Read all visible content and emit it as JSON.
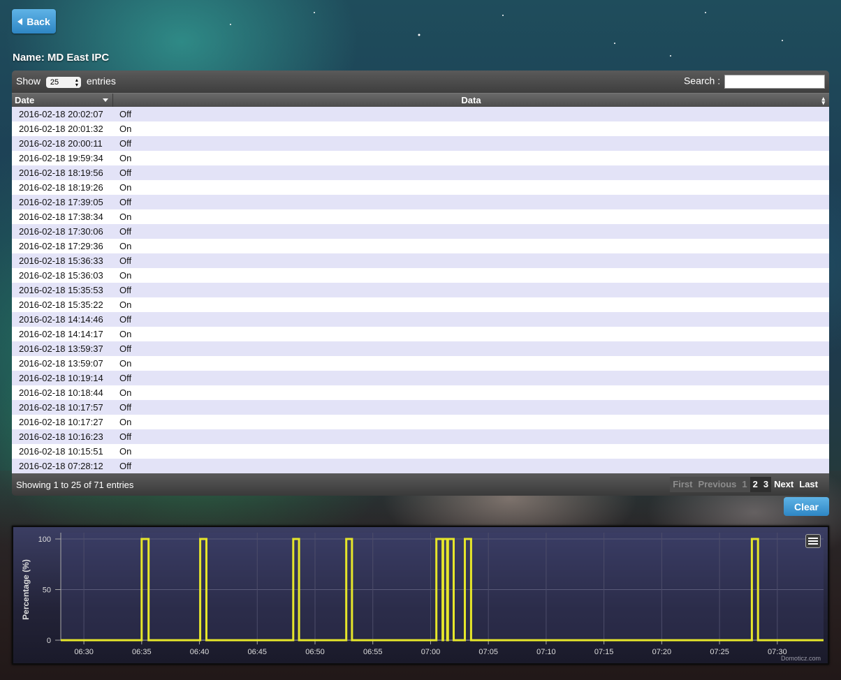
{
  "page": {
    "back_label": "Back",
    "name_label": "Name:",
    "name_value": "MD East IPC"
  },
  "table_controls": {
    "show_prefix": "Show",
    "page_size": "25",
    "show_suffix": "entries",
    "search_label": "Search :",
    "search_value": ""
  },
  "columns": [
    "Date",
    "Data"
  ],
  "rows": [
    {
      "date": "2016-02-18 20:02:07",
      "data": "Off"
    },
    {
      "date": "2016-02-18 20:01:32",
      "data": "On"
    },
    {
      "date": "2016-02-18 20:00:11",
      "data": "Off"
    },
    {
      "date": "2016-02-18 19:59:34",
      "data": "On"
    },
    {
      "date": "2016-02-18 18:19:56",
      "data": "Off"
    },
    {
      "date": "2016-02-18 18:19:26",
      "data": "On"
    },
    {
      "date": "2016-02-18 17:39:05",
      "data": "Off"
    },
    {
      "date": "2016-02-18 17:38:34",
      "data": "On"
    },
    {
      "date": "2016-02-18 17:30:06",
      "data": "Off"
    },
    {
      "date": "2016-02-18 17:29:36",
      "data": "On"
    },
    {
      "date": "2016-02-18 15:36:33",
      "data": "Off"
    },
    {
      "date": "2016-02-18 15:36:03",
      "data": "On"
    },
    {
      "date": "2016-02-18 15:35:53",
      "data": "Off"
    },
    {
      "date": "2016-02-18 15:35:22",
      "data": "On"
    },
    {
      "date": "2016-02-18 14:14:46",
      "data": "Off"
    },
    {
      "date": "2016-02-18 14:14:17",
      "data": "On"
    },
    {
      "date": "2016-02-18 13:59:37",
      "data": "Off"
    },
    {
      "date": "2016-02-18 13:59:07",
      "data": "On"
    },
    {
      "date": "2016-02-18 10:19:14",
      "data": "Off"
    },
    {
      "date": "2016-02-18 10:18:44",
      "data": "On"
    },
    {
      "date": "2016-02-18 10:17:57",
      "data": "Off"
    },
    {
      "date": "2016-02-18 10:17:27",
      "data": "On"
    },
    {
      "date": "2016-02-18 10:16:23",
      "data": "Off"
    },
    {
      "date": "2016-02-18 10:15:51",
      "data": "On"
    },
    {
      "date": "2016-02-18 07:28:12",
      "data": "Off"
    }
  ],
  "footer": {
    "info": "Showing 1 to 25 of 71 entries",
    "pager": [
      "First",
      "Previous",
      "1",
      "2",
      "3",
      "Next",
      "Last"
    ]
  },
  "clear_label": "Clear",
  "chart_data": {
    "type": "line",
    "title": "",
    "xlabel": "",
    "ylabel": "Percentage (%)",
    "credit": "Domoticz.com",
    "line_color": "#e6e62a",
    "ylim": [
      0,
      100
    ],
    "yticks": [
      0,
      50,
      100
    ],
    "xlim": [
      "06:28",
      "06:34"
    ],
    "xticks": [
      "06:30",
      "06:35",
      "06:40",
      "06:45",
      "06:50",
      "06:55",
      "07:00",
      "07:05",
      "07:10",
      "07:15",
      "07:20",
      "07:25",
      "07:30"
    ],
    "series": [
      {
        "points": [
          [
            "06:35:00",
            0
          ],
          [
            "06:35:00",
            100
          ],
          [
            "06:35:36",
            100
          ],
          [
            "06:35:36",
            0
          ],
          [
            "06:40:04",
            0
          ],
          [
            "06:40:04",
            100
          ],
          [
            "06:40:36",
            100
          ],
          [
            "06:40:36",
            0
          ],
          [
            "06:48:07",
            0
          ],
          [
            "06:48:07",
            100
          ],
          [
            "06:48:37",
            100
          ],
          [
            "06:48:37",
            0
          ],
          [
            "06:52:42",
            0
          ],
          [
            "06:52:42",
            100
          ],
          [
            "06:53:12",
            100
          ],
          [
            "06:53:12",
            0
          ],
          [
            "07:00:30",
            0
          ],
          [
            "07:00:30",
            100
          ],
          [
            "07:01:02",
            100
          ],
          [
            "07:01:02",
            0
          ],
          [
            "07:01:05",
            0
          ],
          [
            "07:01:05",
            100
          ],
          [
            "07:01:26",
            100
          ],
          [
            "07:01:26",
            0
          ],
          [
            "07:01:30",
            0
          ],
          [
            "07:01:30",
            100
          ],
          [
            "07:02:00",
            100
          ],
          [
            "07:02:00",
            0
          ],
          [
            "07:02:58",
            0
          ],
          [
            "07:02:58",
            100
          ],
          [
            "07:03:30",
            100
          ],
          [
            "07:03:30",
            0
          ],
          [
            "07:27:48",
            0
          ],
          [
            "07:27:48",
            100
          ],
          [
            "07:28:20",
            100
          ],
          [
            "07:28:20",
            0
          ]
        ]
      }
    ]
  }
}
